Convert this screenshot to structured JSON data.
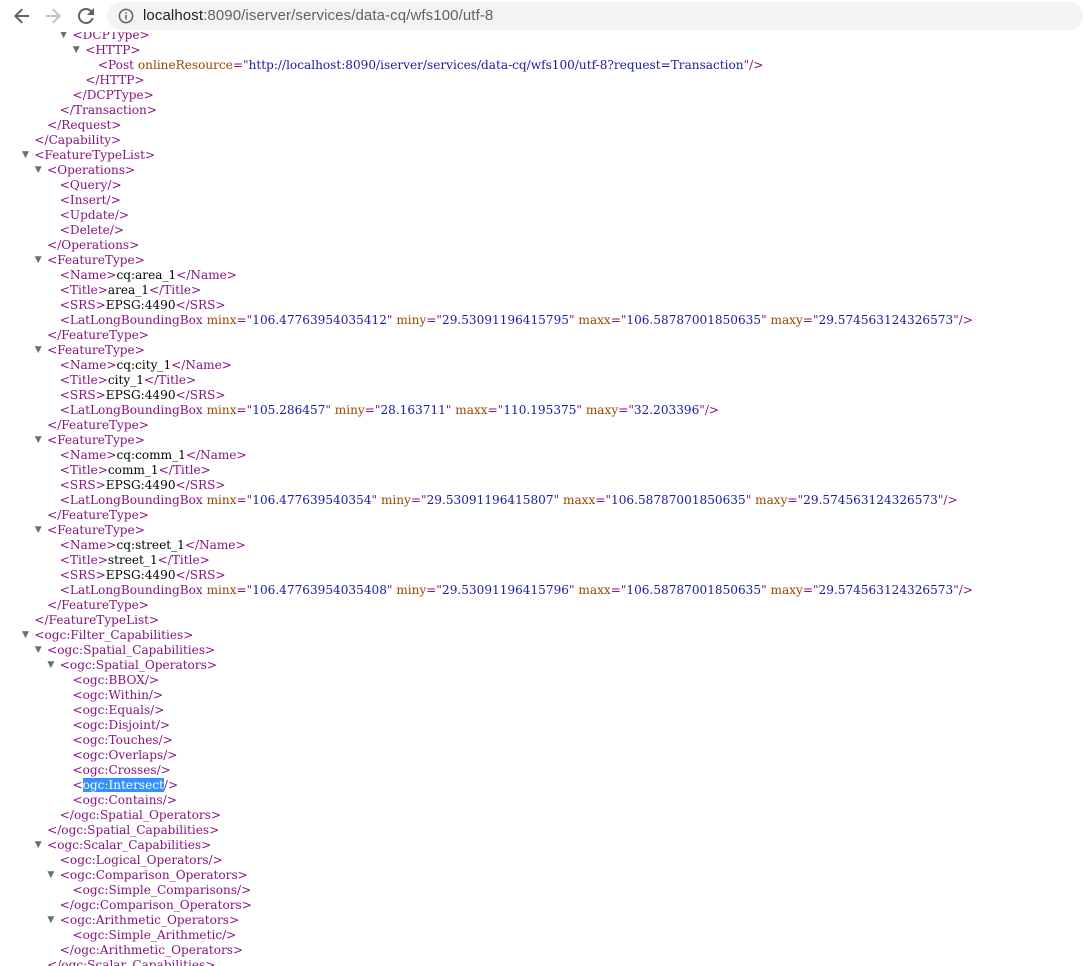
{
  "browser": {
    "url_host": "localhost",
    "url_path": ":8090/iserver/services/data-cq/wfs100/utf-8"
  },
  "xml_lines": [
    {
      "indent": 5,
      "arrow": true,
      "parts": [
        [
          "tag",
          "<DCPType>"
        ]
      ]
    },
    {
      "indent": 6,
      "arrow": true,
      "parts": [
        [
          "tag",
          "<HTTP>"
        ]
      ]
    },
    {
      "indent": 7,
      "parts": [
        [
          "tag",
          "<Post "
        ],
        [
          "attr",
          "onlineResource"
        ],
        [
          "tag",
          "=\""
        ],
        [
          "val",
          "http://localhost:8090/iserver/services/data-cq/wfs100/utf-8?request=Transaction"
        ],
        [
          "tag",
          "\"/>"
        ]
      ]
    },
    {
      "indent": 6,
      "parts": [
        [
          "tag",
          "</HTTP>"
        ]
      ]
    },
    {
      "indent": 5,
      "parts": [
        [
          "tag",
          "</DCPType>"
        ]
      ]
    },
    {
      "indent": 4,
      "parts": [
        [
          "tag",
          "</Transaction>"
        ]
      ]
    },
    {
      "indent": 3,
      "parts": [
        [
          "tag",
          "</Request>"
        ]
      ]
    },
    {
      "indent": 2,
      "parts": [
        [
          "tag",
          "</Capability>"
        ]
      ]
    },
    {
      "indent": 2,
      "arrow": true,
      "parts": [
        [
          "tag",
          "<FeatureTypeList>"
        ]
      ]
    },
    {
      "indent": 3,
      "arrow": true,
      "parts": [
        [
          "tag",
          "<Operations>"
        ]
      ]
    },
    {
      "indent": 4,
      "parts": [
        [
          "tag",
          "<Query/>"
        ]
      ]
    },
    {
      "indent": 4,
      "parts": [
        [
          "tag",
          "<Insert/>"
        ]
      ]
    },
    {
      "indent": 4,
      "parts": [
        [
          "tag",
          "<Update/>"
        ]
      ]
    },
    {
      "indent": 4,
      "parts": [
        [
          "tag",
          "<Delete/>"
        ]
      ]
    },
    {
      "indent": 3,
      "parts": [
        [
          "tag",
          "</Operations>"
        ]
      ]
    },
    {
      "indent": 3,
      "arrow": true,
      "parts": [
        [
          "tag",
          "<FeatureType>"
        ]
      ]
    },
    {
      "indent": 4,
      "parts": [
        [
          "tag",
          "<Name>"
        ],
        [
          "txt",
          "cq:area_1"
        ],
        [
          "tag",
          "</Name>"
        ]
      ]
    },
    {
      "indent": 4,
      "parts": [
        [
          "tag",
          "<Title>"
        ],
        [
          "txt",
          "area_1"
        ],
        [
          "tag",
          "</Title>"
        ]
      ]
    },
    {
      "indent": 4,
      "parts": [
        [
          "tag",
          "<SRS>"
        ],
        [
          "txt",
          "EPSG:4490"
        ],
        [
          "tag",
          "</SRS>"
        ]
      ]
    },
    {
      "indent": 4,
      "parts": [
        [
          "tag",
          "<LatLongBoundingBox "
        ],
        [
          "attr",
          "minx"
        ],
        [
          "tag",
          "=\""
        ],
        [
          "val",
          "106.47763954035412"
        ],
        [
          "tag",
          "\" "
        ],
        [
          "attr",
          "miny"
        ],
        [
          "tag",
          "=\""
        ],
        [
          "val",
          "29.53091196415795"
        ],
        [
          "tag",
          "\" "
        ],
        [
          "attr",
          "maxx"
        ],
        [
          "tag",
          "=\""
        ],
        [
          "val",
          "106.58787001850635"
        ],
        [
          "tag",
          "\" "
        ],
        [
          "attr",
          "maxy"
        ],
        [
          "tag",
          "=\""
        ],
        [
          "val",
          "29.574563124326573"
        ],
        [
          "tag",
          "\"/>"
        ]
      ]
    },
    {
      "indent": 3,
      "parts": [
        [
          "tag",
          "</FeatureType>"
        ]
      ]
    },
    {
      "indent": 3,
      "arrow": true,
      "parts": [
        [
          "tag",
          "<FeatureType>"
        ]
      ]
    },
    {
      "indent": 4,
      "parts": [
        [
          "tag",
          "<Name>"
        ],
        [
          "txt",
          "cq:city_1"
        ],
        [
          "tag",
          "</Name>"
        ]
      ]
    },
    {
      "indent": 4,
      "parts": [
        [
          "tag",
          "<Title>"
        ],
        [
          "txt",
          "city_1"
        ],
        [
          "tag",
          "</Title>"
        ]
      ]
    },
    {
      "indent": 4,
      "parts": [
        [
          "tag",
          "<SRS>"
        ],
        [
          "txt",
          "EPSG:4490"
        ],
        [
          "tag",
          "</SRS>"
        ]
      ]
    },
    {
      "indent": 4,
      "parts": [
        [
          "tag",
          "<LatLongBoundingBox "
        ],
        [
          "attr",
          "minx"
        ],
        [
          "tag",
          "=\""
        ],
        [
          "val",
          "105.286457"
        ],
        [
          "tag",
          "\" "
        ],
        [
          "attr",
          "miny"
        ],
        [
          "tag",
          "=\""
        ],
        [
          "val",
          "28.163711"
        ],
        [
          "tag",
          "\" "
        ],
        [
          "attr",
          "maxx"
        ],
        [
          "tag",
          "=\""
        ],
        [
          "val",
          "110.195375"
        ],
        [
          "tag",
          "\" "
        ],
        [
          "attr",
          "maxy"
        ],
        [
          "tag",
          "=\""
        ],
        [
          "val",
          "32.203396"
        ],
        [
          "tag",
          "\"/>"
        ]
      ]
    },
    {
      "indent": 3,
      "parts": [
        [
          "tag",
          "</FeatureType>"
        ]
      ]
    },
    {
      "indent": 3,
      "arrow": true,
      "parts": [
        [
          "tag",
          "<FeatureType>"
        ]
      ]
    },
    {
      "indent": 4,
      "parts": [
        [
          "tag",
          "<Name>"
        ],
        [
          "txt",
          "cq:comm_1"
        ],
        [
          "tag",
          "</Name>"
        ]
      ]
    },
    {
      "indent": 4,
      "parts": [
        [
          "tag",
          "<Title>"
        ],
        [
          "txt",
          "comm_1"
        ],
        [
          "tag",
          "</Title>"
        ]
      ]
    },
    {
      "indent": 4,
      "parts": [
        [
          "tag",
          "<SRS>"
        ],
        [
          "txt",
          "EPSG:4490"
        ],
        [
          "tag",
          "</SRS>"
        ]
      ]
    },
    {
      "indent": 4,
      "parts": [
        [
          "tag",
          "<LatLongBoundingBox "
        ],
        [
          "attr",
          "minx"
        ],
        [
          "tag",
          "=\""
        ],
        [
          "val",
          "106.477639540354"
        ],
        [
          "tag",
          "\" "
        ],
        [
          "attr",
          "miny"
        ],
        [
          "tag",
          "=\""
        ],
        [
          "val",
          "29.53091196415807"
        ],
        [
          "tag",
          "\" "
        ],
        [
          "attr",
          "maxx"
        ],
        [
          "tag",
          "=\""
        ],
        [
          "val",
          "106.58787001850635"
        ],
        [
          "tag",
          "\" "
        ],
        [
          "attr",
          "maxy"
        ],
        [
          "tag",
          "=\""
        ],
        [
          "val",
          "29.574563124326573"
        ],
        [
          "tag",
          "\"/>"
        ]
      ]
    },
    {
      "indent": 3,
      "parts": [
        [
          "tag",
          "</FeatureType>"
        ]
      ]
    },
    {
      "indent": 3,
      "arrow": true,
      "parts": [
        [
          "tag",
          "<FeatureType>"
        ]
      ]
    },
    {
      "indent": 4,
      "parts": [
        [
          "tag",
          "<Name>"
        ],
        [
          "txt",
          "cq:street_1"
        ],
        [
          "tag",
          "</Name>"
        ]
      ]
    },
    {
      "indent": 4,
      "parts": [
        [
          "tag",
          "<Title>"
        ],
        [
          "txt",
          "street_1"
        ],
        [
          "tag",
          "</Title>"
        ]
      ]
    },
    {
      "indent": 4,
      "parts": [
        [
          "tag",
          "<SRS>"
        ],
        [
          "txt",
          "EPSG:4490"
        ],
        [
          "tag",
          "</SRS>"
        ]
      ]
    },
    {
      "indent": 4,
      "parts": [
        [
          "tag",
          "<LatLongBoundingBox "
        ],
        [
          "attr",
          "minx"
        ],
        [
          "tag",
          "=\""
        ],
        [
          "val",
          "106.47763954035408"
        ],
        [
          "tag",
          "\" "
        ],
        [
          "attr",
          "miny"
        ],
        [
          "tag",
          "=\""
        ],
        [
          "val",
          "29.53091196415796"
        ],
        [
          "tag",
          "\" "
        ],
        [
          "attr",
          "maxx"
        ],
        [
          "tag",
          "=\""
        ],
        [
          "val",
          "106.58787001850635"
        ],
        [
          "tag",
          "\" "
        ],
        [
          "attr",
          "maxy"
        ],
        [
          "tag",
          "=\""
        ],
        [
          "val",
          "29.574563124326573"
        ],
        [
          "tag",
          "\"/>"
        ]
      ]
    },
    {
      "indent": 3,
      "parts": [
        [
          "tag",
          "</FeatureType>"
        ]
      ]
    },
    {
      "indent": 2,
      "parts": [
        [
          "tag",
          "</FeatureTypeList>"
        ]
      ]
    },
    {
      "indent": 2,
      "arrow": true,
      "parts": [
        [
          "tag",
          "<ogc:Filter_Capabilities>"
        ]
      ]
    },
    {
      "indent": 3,
      "arrow": true,
      "parts": [
        [
          "tag",
          "<ogc:Spatial_Capabilities>"
        ]
      ]
    },
    {
      "indent": 4,
      "arrow": true,
      "parts": [
        [
          "tag",
          "<ogc:Spatial_Operators>"
        ]
      ]
    },
    {
      "indent": 5,
      "parts": [
        [
          "tag",
          "<ogc:BBOX/>"
        ]
      ]
    },
    {
      "indent": 5,
      "parts": [
        [
          "tag",
          "<ogc:Within/>"
        ]
      ]
    },
    {
      "indent": 5,
      "parts": [
        [
          "tag",
          "<ogc:Equals/>"
        ]
      ]
    },
    {
      "indent": 5,
      "parts": [
        [
          "tag",
          "<ogc:Disjoint/>"
        ]
      ]
    },
    {
      "indent": 5,
      "parts": [
        [
          "tag",
          "<ogc:Touches/>"
        ]
      ]
    },
    {
      "indent": 5,
      "parts": [
        [
          "tag",
          "<ogc:Overlaps/>"
        ]
      ]
    },
    {
      "indent": 5,
      "parts": [
        [
          "tag",
          "<ogc:Crosses/>"
        ]
      ]
    },
    {
      "indent": 5,
      "parts": [
        [
          "tag",
          "<"
        ],
        [
          "sel",
          "ogc:Intersect"
        ],
        [
          "tag",
          "/>"
        ]
      ]
    },
    {
      "indent": 5,
      "parts": [
        [
          "tag",
          "<ogc:Contains/>"
        ]
      ]
    },
    {
      "indent": 4,
      "parts": [
        [
          "tag",
          "</ogc:Spatial_Operators>"
        ]
      ]
    },
    {
      "indent": 3,
      "parts": [
        [
          "tag",
          "</ogc:Spatial_Capabilities>"
        ]
      ]
    },
    {
      "indent": 3,
      "arrow": true,
      "parts": [
        [
          "tag",
          "<ogc:Scalar_Capabilities>"
        ]
      ]
    },
    {
      "indent": 4,
      "parts": [
        [
          "tag",
          "<ogc:Logical_Operators/>"
        ]
      ]
    },
    {
      "indent": 4,
      "arrow": true,
      "parts": [
        [
          "tag",
          "<ogc:Comparison_Operators>"
        ]
      ]
    },
    {
      "indent": 5,
      "parts": [
        [
          "tag",
          "<ogc:Simple_Comparisons/>"
        ]
      ]
    },
    {
      "indent": 4,
      "parts": [
        [
          "tag",
          "</ogc:Comparison_Operators>"
        ]
      ]
    },
    {
      "indent": 4,
      "arrow": true,
      "parts": [
        [
          "tag",
          "<ogc:Arithmetic_Operators>"
        ]
      ]
    },
    {
      "indent": 5,
      "parts": [
        [
          "tag",
          "<ogc:Simple_Arithmetic/>"
        ]
      ]
    },
    {
      "indent": 4,
      "parts": [
        [
          "tag",
          "</ogc:Arithmetic_Operators>"
        ]
      ]
    },
    {
      "indent": 3,
      "parts": [
        [
          "tag",
          "</ogc:Scalar_Capabilities>"
        ]
      ]
    }
  ]
}
